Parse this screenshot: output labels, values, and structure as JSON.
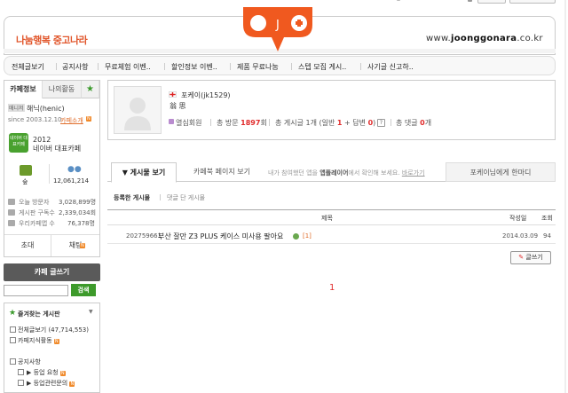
{
  "header": {
    "brand": "나눔행복 중고나라",
    "url_prefix": "www.",
    "url_bold": "joonggonara",
    "url_suffix": ".co.kr"
  },
  "menu": [
    "전체글보기",
    "공지사항",
    "무료체험 이벤..",
    "할인정보 이벤..",
    "제품 무료나눔",
    "스텝 모집 게시..",
    "사기글 신고하.."
  ],
  "sidebar": {
    "tab_cafe_info": "카페정보",
    "tab_my_activity": "나의활동",
    "tab_star": "★",
    "manager_badge": "매니저",
    "manager_name": "해닉(henic)",
    "since": "since 2003.12.10",
    "cafe_intro": "카페소개",
    "n": "N",
    "naver_badge": "네이버 대표카페",
    "year": "2012",
    "rep_cafe": "네이버 대표카페",
    "grade": "숲",
    "members": "12,061,214",
    "stats": [
      {
        "label": "오늘 방문자",
        "value": "3,028,899명"
      },
      {
        "label": "게시판 구독수",
        "value": "2,339,034회"
      },
      {
        "label": "우리카페앱 수",
        "value": "76,378명"
      }
    ],
    "invite": "초대",
    "chat": "채팅",
    "write_cafe": "카페 글쓰기",
    "search_placeholder": "",
    "search_btn": "검색",
    "fav_title": "즐겨찾는 게시판",
    "fav_caret": "▼",
    "boards": [
      {
        "label": "전체글보기",
        "count": "(47,714,553)"
      },
      {
        "label": "카페지식활동",
        "count": ""
      },
      {
        "label": "공지사항",
        "count": ""
      },
      {
        "label": "▶ 등업 요청",
        "count": ""
      },
      {
        "label": "▶ 등업관련문의",
        "count": ""
      }
    ]
  },
  "profile": {
    "nick": "포케이(jk1529)",
    "kanji": "翁 思",
    "level": "열심회원",
    "visits_label": "총 방문",
    "visits_value": "1897",
    "visits_unit": "회",
    "posts_label": "총 게시글",
    "posts_value": "1개 (일반",
    "posts_general": "1",
    "posts_answer_label": "+ 답변",
    "posts_answer": "0",
    "posts_close": ")",
    "help": "?",
    "comments_label": "총 댓글",
    "comments_value": "0",
    "comments_unit": "개"
  },
  "tabs": {
    "active": "▼ 게시물 보기",
    "cafe_page": "카페북 페이지 보기",
    "notice_pre": "내가 참여했던 앱을 ",
    "notice_bold": "앱플레이어",
    "notice_post": "에서 확인해 보세요. ",
    "notice_link": "바로가기",
    "onelist": "포케이님에게 한마디"
  },
  "subtabs": {
    "posts": "등록한 게시물",
    "comments": "댓글 단 게시물"
  },
  "table": {
    "headers": {
      "title": "제목",
      "date": "작성일",
      "views": "조회"
    },
    "rows": [
      {
        "id": "202759661",
        "title": "부산 잘만 Z3 PLUS 케이스 미사용 팔아요",
        "comments": "[1]",
        "date": "2014.03.09",
        "views": "94"
      }
    ]
  },
  "write_btn": "글쓰기",
  "pagination": {
    "current": "1"
  }
}
